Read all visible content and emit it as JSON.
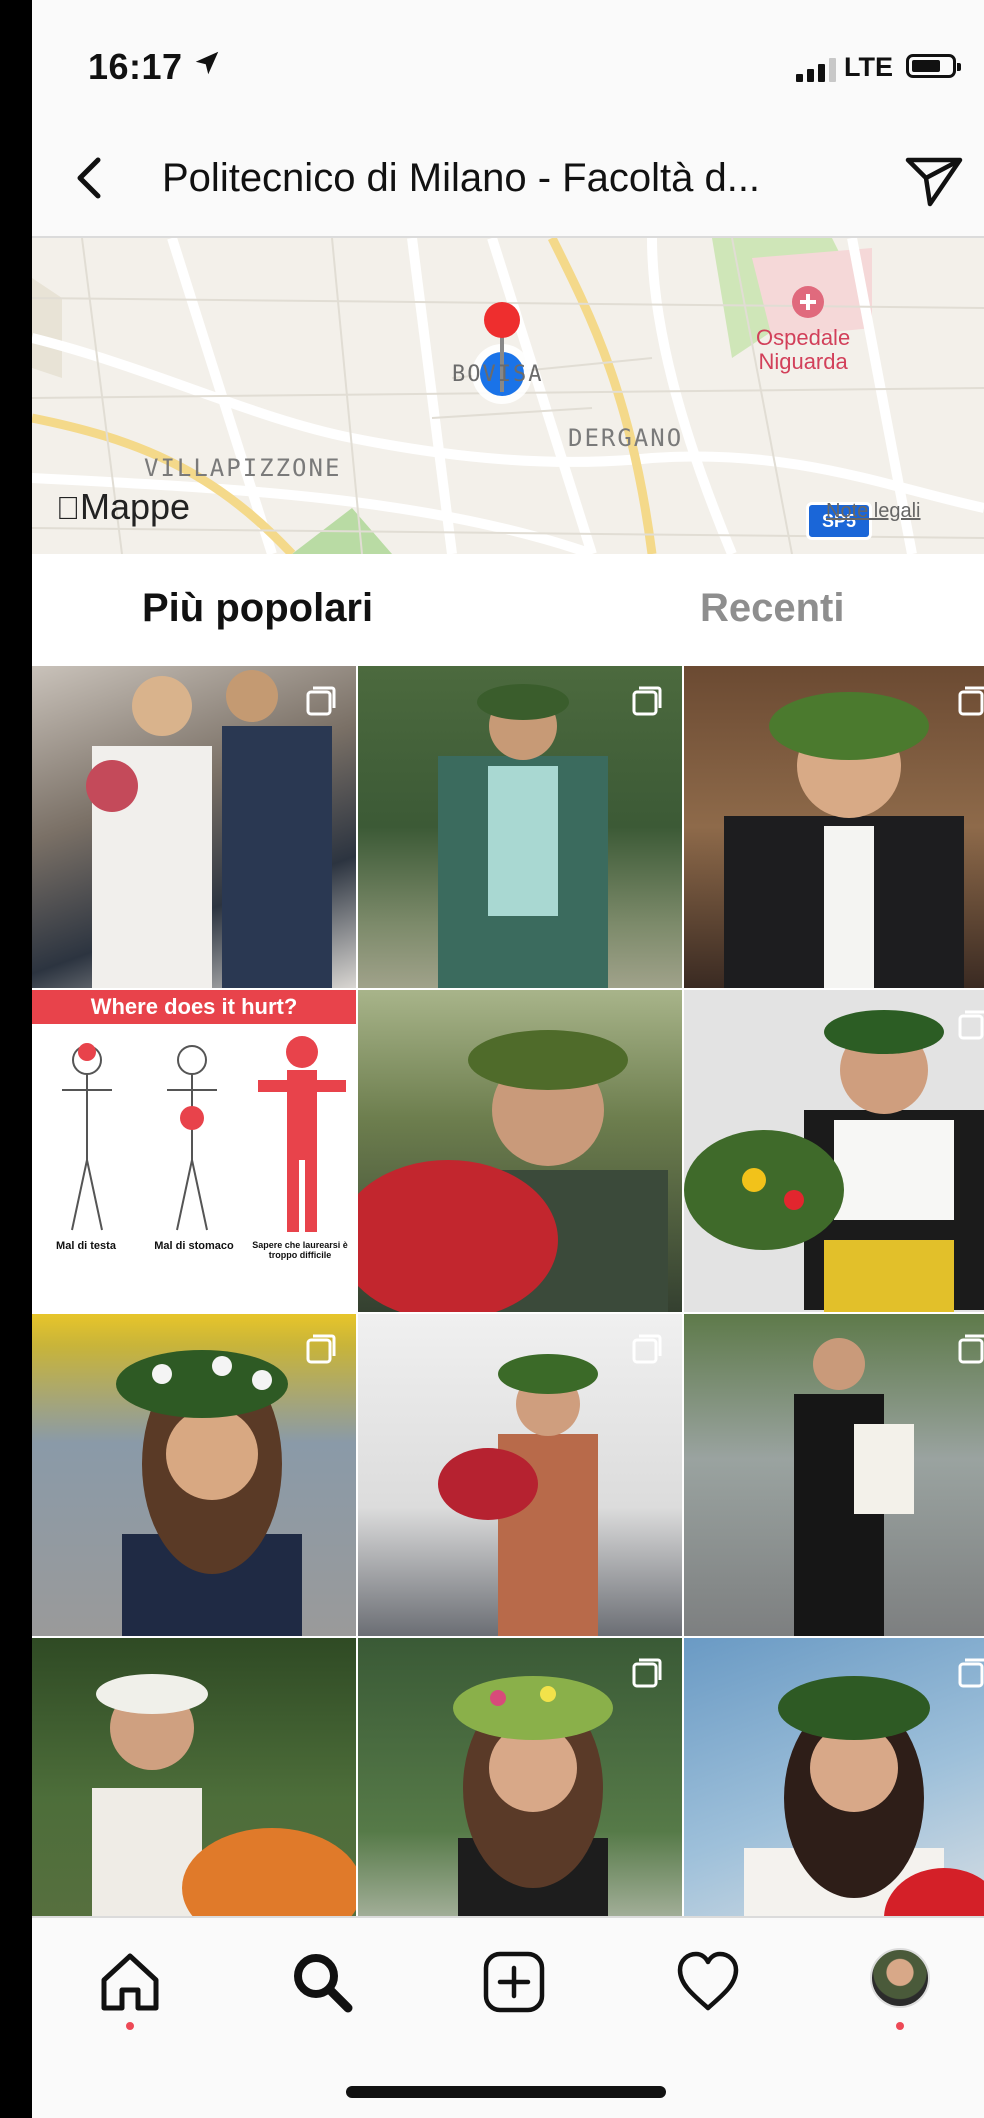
{
  "status_bar": {
    "time": "16:17",
    "carrier": "LTE"
  },
  "header": {
    "title": "Politecnico di Milano - Facoltà d..."
  },
  "map": {
    "labels": {
      "villa": "VILLAPIZZONE",
      "dergano": "DERGANO",
      "bovisa": "BOVISA",
      "hospital": "Ospedale\nNiguarda"
    },
    "attribution": "Mappe",
    "legal": "Note legali",
    "shield": "SP5"
  },
  "tabs": {
    "popular": "Più popolari",
    "recent": "Recenti"
  },
  "grid": {
    "graphic": {
      "title": "Where does it hurt?",
      "captions": [
        "Mal di testa",
        "Mal di stomaco",
        "Sapere che laurearsi è troppo difficile"
      ]
    }
  },
  "colors": {
    "accent": "#ed4956",
    "brand_red": "#e8434b",
    "map_pin_blue": "#1a73e8"
  },
  "nav": {
    "icons": [
      "home-icon",
      "search-icon",
      "add-post-icon",
      "heart-icon",
      "profile-avatar"
    ]
  }
}
